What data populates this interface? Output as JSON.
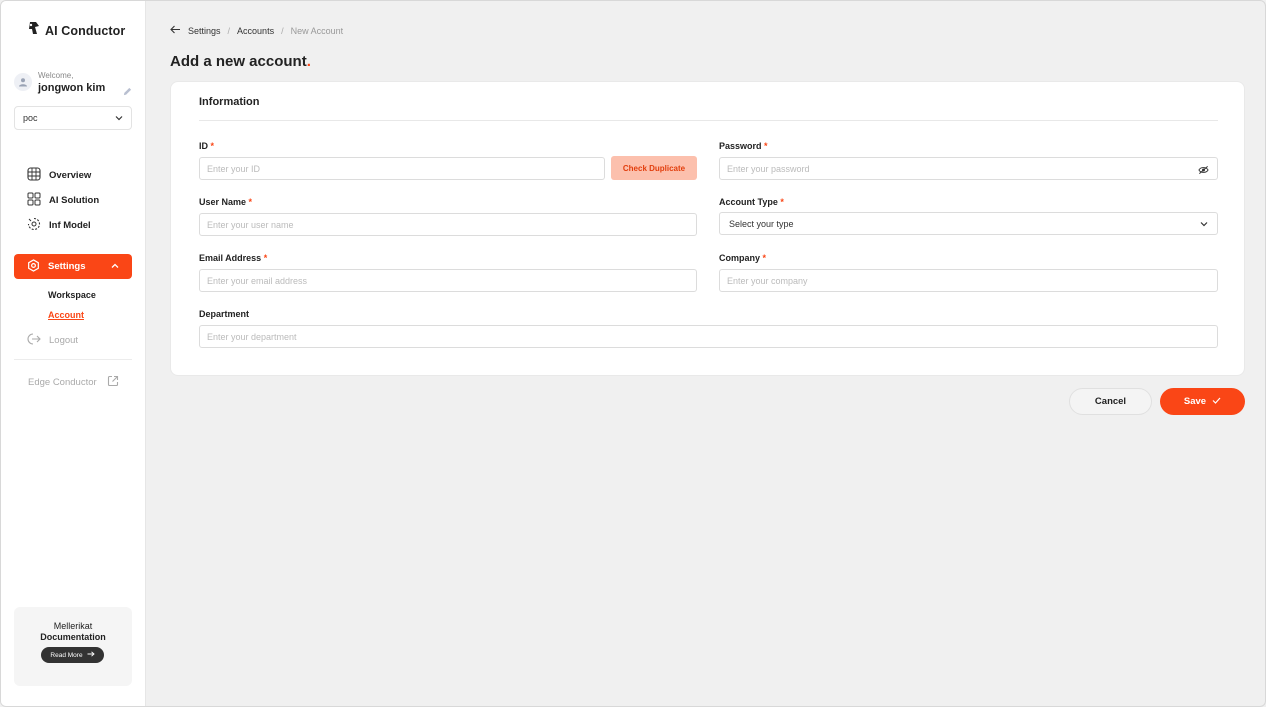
{
  "brand": {
    "name": "AI Conductor",
    "accent": "#fa4616"
  },
  "user": {
    "welcome": "Welcome,",
    "name": "jongwon kim"
  },
  "workspace_select": {
    "value": "poc"
  },
  "nav": {
    "items": [
      {
        "label": "Overview",
        "icon": "overview-icon"
      },
      {
        "label": "AI Solution",
        "icon": "grid-icon"
      },
      {
        "label": "Inf Model",
        "icon": "model-icon"
      }
    ],
    "settings": {
      "label": "Settings",
      "icon": "gear-icon"
    },
    "sub_items": [
      {
        "label": "Workspace"
      },
      {
        "label": "Account"
      }
    ],
    "logout": "Logout",
    "edge": "Edge Conductor"
  },
  "doc_card": {
    "top": "Mellerikat",
    "title": "Documentation",
    "button": "Read More"
  },
  "breadcrumb": {
    "items": [
      "Settings",
      "Accounts",
      "New Account"
    ]
  },
  "page": {
    "title": "Add a new account",
    "title_dot": "."
  },
  "form": {
    "section_title": "Information",
    "id": {
      "label": "ID",
      "placeholder": "Enter your ID",
      "check_button": "Check Duplicate"
    },
    "password": {
      "label": "Password",
      "placeholder": "Enter your password"
    },
    "user_name": {
      "label": "User Name",
      "placeholder": "Enter your user name"
    },
    "account_type": {
      "label": "Account Type",
      "placeholder": "Select your type"
    },
    "email": {
      "label": "Email Address",
      "placeholder": "Enter your email address"
    },
    "company": {
      "label": "Company",
      "placeholder": "Enter your company"
    },
    "department": {
      "label": "Department",
      "placeholder": "Enter your department"
    },
    "required_mark": "*"
  },
  "actions": {
    "cancel": "Cancel",
    "save": "Save"
  }
}
